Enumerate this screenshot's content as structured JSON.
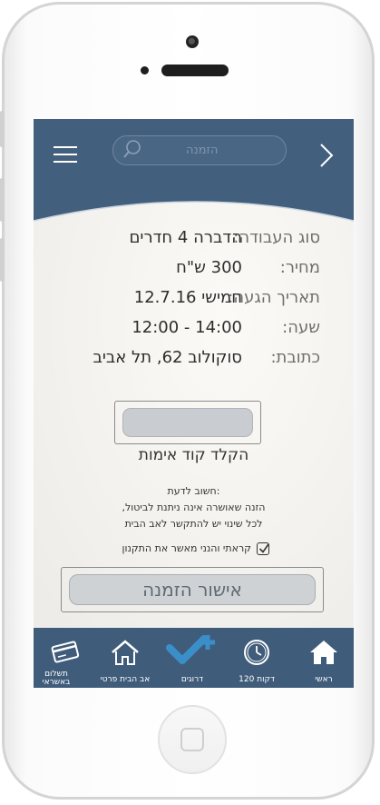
{
  "header": {
    "search_placeholder": "הזמנה"
  },
  "order": {
    "rows": [
      {
        "label": "סוג העבודה:",
        "value": "הדברה 4 חדרים"
      },
      {
        "label": "מחיר:",
        "value": "300 ש\"ח"
      },
      {
        "label": "תאריך הגעה:",
        "value": "חמישי 12.7.16"
      },
      {
        "label": "שעה:",
        "value": "12:00 - 14:00"
      },
      {
        "label": "כתובת:",
        "value": "סוקולוב 62, תל אביב"
      }
    ]
  },
  "verification": {
    "label": "הקלד קוד אימות",
    "value": ""
  },
  "note": {
    "title": "חשוב לדעת:",
    "line1": "הזנה שאושרה אינה ניתנת לביטול,",
    "line2": "לכל שינוי יש להתקשר לאב הבית"
  },
  "terms": {
    "label": "קראתי והנני מאשר את התקנון",
    "checked": true
  },
  "confirm": {
    "label": "אישור הזמנה"
  },
  "tabs": [
    {
      "label": "ראשי",
      "icon": "home-icon"
    },
    {
      "label": "120 דקות",
      "icon": "clock-icon"
    },
    {
      "label": "דרוגים",
      "icon": "rating-check-plus-icon"
    },
    {
      "label": "אב הבית פרטי",
      "icon": "house-icon"
    },
    {
      "label": "תשלום באשראי",
      "icon": "credit-card-icon"
    }
  ],
  "colors": {
    "header": "#435f7e",
    "tabbar": "#405c7b",
    "accent": "#3b8fc9"
  }
}
